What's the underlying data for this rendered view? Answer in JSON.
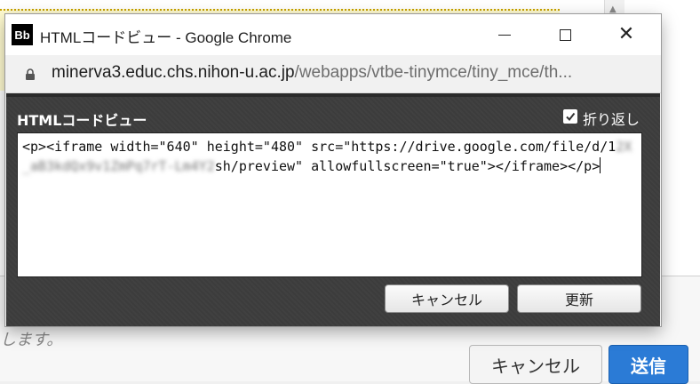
{
  "background_page": {
    "note_text": "します。",
    "cancel_label": "キャンセル",
    "submit_label": "送信"
  },
  "window": {
    "logo_text": "Bb",
    "title": "HTMLコードビュー - Google Chrome"
  },
  "address": {
    "host": "minerva3.educ.chs.nihon-u.ac.jp",
    "path": "/webapps/vtbe-tinymce/tiny_mce/th..."
  },
  "dialog": {
    "title": "HTMLコードビュー",
    "wrap_label": "折り返し",
    "wrap_checked": true,
    "code_before": "<p><iframe width=\"640\" height=\"480\" src=\"https://drive.google.com/file/d/1",
    "code_redacted": "2X_aB3kdQx9v1ZmPq7rT-Lm4Y2",
    "code_after": "sh/preview\" allowfullscreen=\"true\"></iframe></p>",
    "cancel_label": "キャンセル",
    "update_label": "更新"
  },
  "colors": {
    "dialog_bg": "#3c3c3c",
    "submit_blue": "#2b7bd6"
  }
}
